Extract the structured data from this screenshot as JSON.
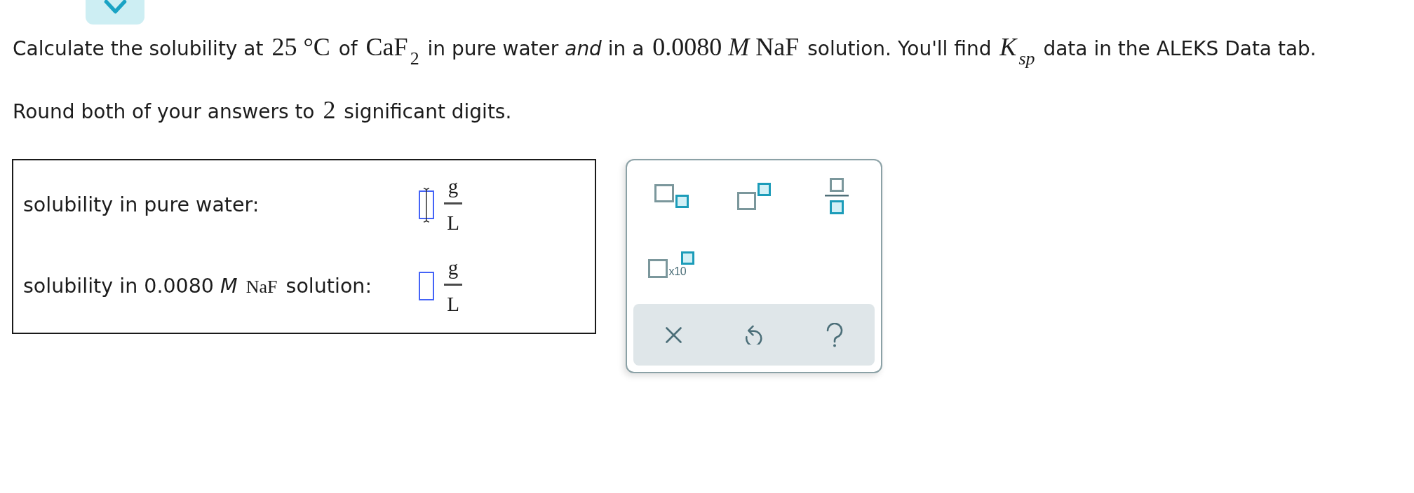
{
  "question": {
    "lines": [
      {
        "parts": [
          {
            "kind": "text",
            "text": "Calculate the solubility at "
          },
          {
            "kind": "math",
            "text": "25 °C"
          },
          {
            "kind": "text",
            "text": " of "
          },
          {
            "kind": "math",
            "text": "CaF$_{2}$"
          },
          {
            "kind": "text",
            "text": " in pure water *and* in a "
          },
          {
            "kind": "math",
            "text": "0.0080 *M* NaF"
          },
          {
            "kind": "text",
            "text": " solution. You'll find "
          },
          {
            "kind": "var",
            "text": "K$_{sp}$"
          },
          {
            "kind": "text",
            "text": " data in the ALEKS Data tab."
          }
        ]
      },
      {
        "parts": [
          {
            "kind": "text",
            "text": "Round both of your answers to "
          },
          {
            "kind": "math",
            "text": "2"
          },
          {
            "kind": "text",
            "text": " significant digits."
          }
        ]
      }
    ]
  },
  "answers": [
    {
      "parts": [
        {
          "kind": "text",
          "text": "solubility in pure water:"
        }
      ],
      "hovered": true,
      "unit": {
        "numerator": "g",
        "denominator": "L"
      }
    },
    {
      "parts": [
        {
          "kind": "text",
          "text": "solubility in 0.0080 *M* "
        },
        {
          "kind": "math",
          "text": "NaF"
        },
        {
          "kind": "text",
          "text": " solution:"
        }
      ],
      "hovered": false,
      "unit": {
        "numerator": "g",
        "denominator": "L"
      }
    }
  ],
  "palette": {
    "tools": [
      {
        "kind": "subscript"
      },
      {
        "kind": "superscript"
      },
      {
        "kind": "fraction"
      },
      {
        "kind": "scientific",
        "label": "x10"
      }
    ],
    "actions": [
      {
        "kind": "clear"
      },
      {
        "kind": "undo"
      },
      {
        "kind": "help"
      }
    ]
  }
}
